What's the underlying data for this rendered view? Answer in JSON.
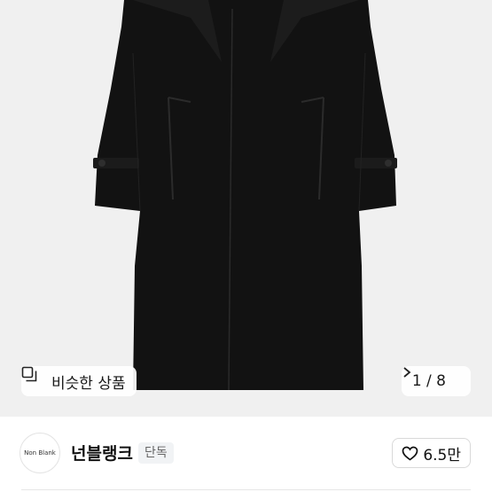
{
  "product": {
    "similar_label": "비슷한 상품",
    "pager_text": "1 / 8"
  },
  "shop": {
    "logo_text": "Non Blank",
    "name": "넌블랭크",
    "badge": "단독",
    "likes": "6.5만"
  },
  "colors": {
    "coat": "#111111",
    "background": "#f0f0f0"
  }
}
